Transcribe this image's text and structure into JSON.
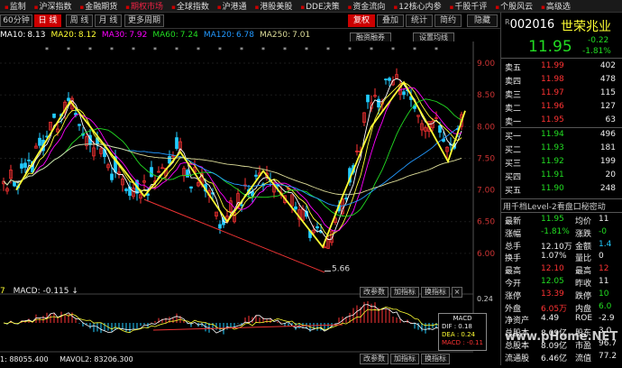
{
  "menu": [
    "监制",
    "沪深指数",
    "金融期货",
    "期权市场",
    "全球指数",
    "沪港通",
    "港股美股",
    "DDE决策",
    "资金流向",
    "12核心内参",
    "千股千评",
    "个股风云",
    "高级选"
  ],
  "menu_active_index": 3,
  "toolbar": {
    "period_60": "60分钟",
    "day": "日 线",
    "week": "周 线",
    "month": "月 线",
    "more": "更多周期",
    "restore": "复权",
    "overlay": "叠加",
    "stats": "统计",
    "simple": "简约",
    "hide": "隐藏",
    "margin": "融资融券",
    "set_ma": "设置均线"
  },
  "ma_legend": [
    {
      "label": "MA10:",
      "value": "8.13",
      "color": "#ffffff"
    },
    {
      "label": "MA20:",
      "value": "8.12",
      "color": "#ff3"
    },
    {
      "label": "MA30:",
      "value": "7.92",
      "color": "#f0f"
    },
    {
      "label": "MA60:",
      "value": "7.24",
      "color": "#2d2"
    },
    {
      "label": "MA120:",
      "value": "6.78",
      "color": "#29f"
    },
    {
      "label": "MA250:",
      "value": "7.01",
      "color": "#dd9"
    }
  ],
  "price_axis": [
    "9.00",
    "8.50",
    "8.00",
    "7.50",
    "7.00",
    "6.50",
    "6.00"
  ],
  "low_marker": "5.66",
  "macd_legend": {
    "prefix": "7",
    "label": "MACD:",
    "value": "-0.115"
  },
  "macd_axis_top": "0.24",
  "macd_box": {
    "title": "MACD",
    "dif": "DIF : 0.18",
    "dea": "DEA : 0.24",
    "macd": "MACD : -0.11"
  },
  "sub_buttons": [
    "改参数",
    "加指标",
    "换指标"
  ],
  "bottom_legend": {
    "left": "1: 88055.400",
    "mavol2": "MAVOL2: 83206.300"
  },
  "watermark": "www.pHome.NET",
  "quote": {
    "code": "002016",
    "name": "世荣兆业",
    "price": "11.95",
    "change": "-0.22",
    "change_pct": "-1.81%",
    "asks": [
      {
        "label": "卖五",
        "price": "11.99",
        "vol": "402"
      },
      {
        "label": "卖四",
        "price": "11.98",
        "vol": "478"
      },
      {
        "label": "卖三",
        "price": "11.97",
        "vol": "115"
      },
      {
        "label": "卖二",
        "price": "11.96",
        "vol": "127"
      },
      {
        "label": "卖一",
        "price": "11.95",
        "vol": "63"
      }
    ],
    "bids": [
      {
        "label": "买一",
        "price": "11.94",
        "vol": "496"
      },
      {
        "label": "买二",
        "price": "11.93",
        "vol": "181"
      },
      {
        "label": "买三",
        "price": "11.92",
        "vol": "199"
      },
      {
        "label": "买四",
        "price": "11.91",
        "vol": "20"
      },
      {
        "label": "买五",
        "price": "11.90",
        "vol": "248"
      }
    ],
    "level2_text": "用千档Level-2看盘口秘密动",
    "stats": [
      {
        "l1": "最新",
        "v1": "11.95",
        "c1": "green",
        "l2": "均价",
        "v2": "11",
        "c2": "white"
      },
      {
        "l1": "涨幅",
        "v1": "-1.81%",
        "c1": "green",
        "l2": "涨跌",
        "v2": "-0",
        "c2": "green"
      },
      {
        "l1": "总手",
        "v1": "12.10万",
        "c1": "white",
        "l2": "金额",
        "v2": "1.4",
        "c2": "cyan"
      },
      {
        "l1": "换手",
        "v1": "1.07%",
        "c1": "white",
        "l2": "量比",
        "v2": "0",
        "c2": "white"
      },
      {
        "l1": "最高",
        "v1": "12.10",
        "c1": "red",
        "l2": "最高",
        "v2": "12",
        "c2": "red"
      },
      {
        "l1": "今开",
        "v1": "12.05",
        "c1": "green",
        "l2": "昨收",
        "v2": "11",
        "c2": "white"
      },
      {
        "l1": "涨停",
        "v1": "13.39",
        "c1": "red",
        "l2": "跌停",
        "v2": "10",
        "c2": "green"
      },
      {
        "l1": "外盘",
        "v1": "6.05万",
        "c1": "red",
        "l2": "内盘",
        "v2": "6.0",
        "c2": "green"
      },
      {
        "l1": "净资产",
        "v1": "4.49",
        "c1": "white",
        "l2": "ROE",
        "v2": "-2.9",
        "c2": "white"
      },
      {
        "l1": "总股本",
        "v1": "8.09亿",
        "c1": "white",
        "l2": "股东",
        "v2": "3.0",
        "c2": "white"
      },
      {
        "l1": "总股本",
        "v1": "8.09亿",
        "c1": "white",
        "l2": "市盈",
        "v2": "96.7",
        "c2": "white"
      },
      {
        "l1": "流通股",
        "v1": "6.46亿",
        "c1": "white",
        "l2": "流值",
        "v2": "77.2",
        "c2": "white"
      }
    ]
  }
}
